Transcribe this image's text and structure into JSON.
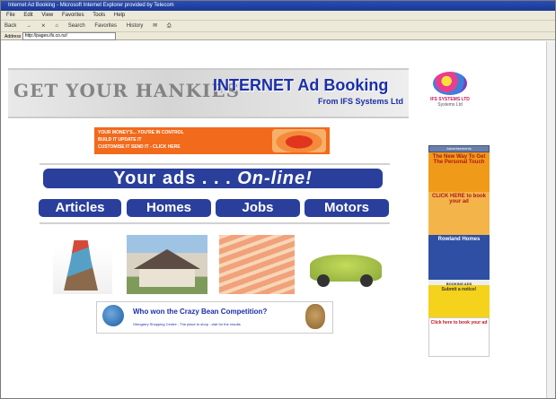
{
  "window": {
    "title": "Internet Ad Booking - Microsoft Internet Explorer provided by Telecom"
  },
  "menu": [
    "File",
    "Edit",
    "View",
    "Favorites",
    "Tools",
    "Help"
  ],
  "toolbar": [
    "Back",
    "→",
    "⨯",
    "⌂",
    "Search",
    "Favorites",
    "History",
    "✉",
    "⎙"
  ],
  "address": {
    "label": "Address",
    "value": "http://pages.ifs.co.nz/"
  },
  "banner": {
    "collage": "GET YOUR HANKIES",
    "title": "INTERNET Ad Booking",
    "subtitle": "From IFS Systems Ltd"
  },
  "logo": {
    "line1": "IFS SYSTEMS LTD",
    "line2": "Systems Ltd"
  },
  "promo": {
    "line1": "YOUR MONEY'S... YOU'RE IN CONTROL",
    "line2": "BUILD IT          UPDATE IT",
    "line3": "CUSTOMISE IT       SEND IT - CLICK HERE"
  },
  "main": {
    "headline": "Your ads . . .",
    "headline_em": "On-line!",
    "nav": [
      "Articles",
      "Homes",
      "Jobs",
      "Motors"
    ],
    "crazy_title": "Who won the Crazy Bean Competition?",
    "crazy_small": "Glengarry Shopping Centre - The place to shop - visit for the results"
  },
  "sidebar": {
    "header": "Advertisements",
    "ad1": "The New Way To Get The Personal Touch",
    "ad2": "CLICK HERE to book your ad",
    "ad3": "Rowland Homes",
    "ad4": "BOOKING ADS",
    "ad5": "Submit a notice!",
    "ad6": "Click here to book your ad"
  }
}
